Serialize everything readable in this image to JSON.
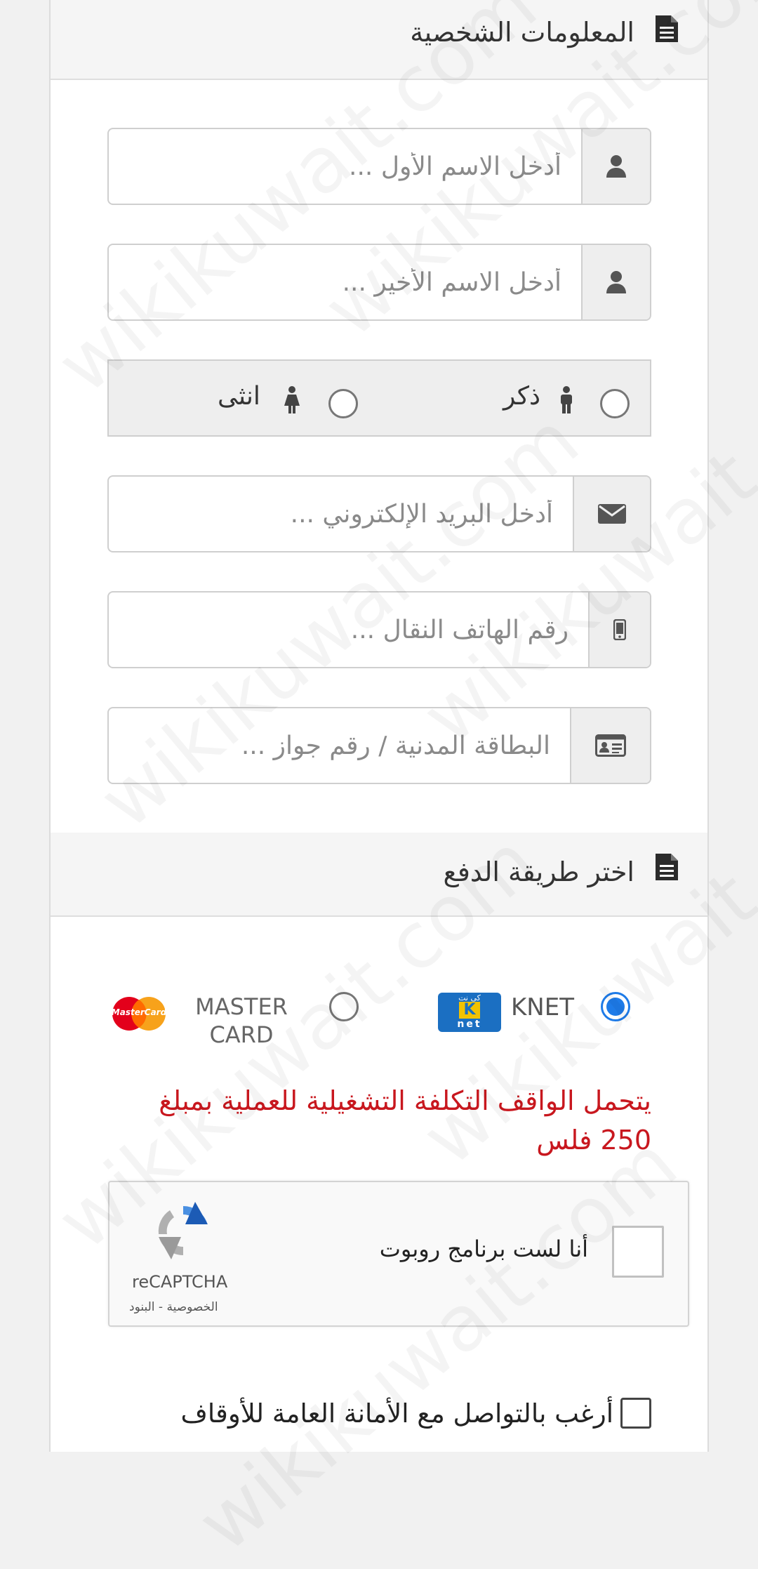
{
  "personal_section": {
    "title": "المعلومات الشخصية",
    "icon": "document-icon"
  },
  "fields": {
    "first_name": {
      "placeholder": "أدخل الاسم الأول ...",
      "icon": "user-icon"
    },
    "last_name": {
      "placeholder": "أدخل الاسم الأخير ...",
      "icon": "user-icon"
    },
    "email": {
      "placeholder": "أدخل البريد الإلكتروني ...",
      "icon": "envelope-icon"
    },
    "mobile": {
      "placeholder": "رقم الهاتف النقال ...",
      "icon": "mobile-icon"
    },
    "civil_id": {
      "placeholder": "البطاقة المدنية / رقم جواز ...",
      "icon": "id-card-icon"
    }
  },
  "gender": {
    "male_label": "ذكر",
    "female_label": "انثى",
    "selected": null
  },
  "payment_section": {
    "title": "اختر طريقة الدفع",
    "icon": "document-icon"
  },
  "payment": {
    "knet_label": "KNET",
    "knet_logo_top": "كي نت",
    "knet_logo_letter": "K",
    "knet_logo_bottom": "net",
    "master_label_line1": "MASTER",
    "master_label_line2": "CARD",
    "mastercard_logo_text": "MasterCard",
    "selected": "KNET"
  },
  "fee_note": "يتحمل الواقف التكلفة التشغيلية للعملية بمبلغ 250 فلس",
  "recaptcha": {
    "checkbox_label": "أنا لست برنامج روبوت",
    "brand": "reCAPTCHA",
    "privacy": "الخصوصية",
    "separator": " - ",
    "terms": "البنود"
  },
  "contact_optin": {
    "label": "أرغب بالتواصل مع الأمانة العامة للأوقاف",
    "checked": false
  },
  "watermark_text": "wikikuwait.com",
  "colors": {
    "accent_blue": "#1e7be8",
    "note_red": "#c8171e"
  }
}
